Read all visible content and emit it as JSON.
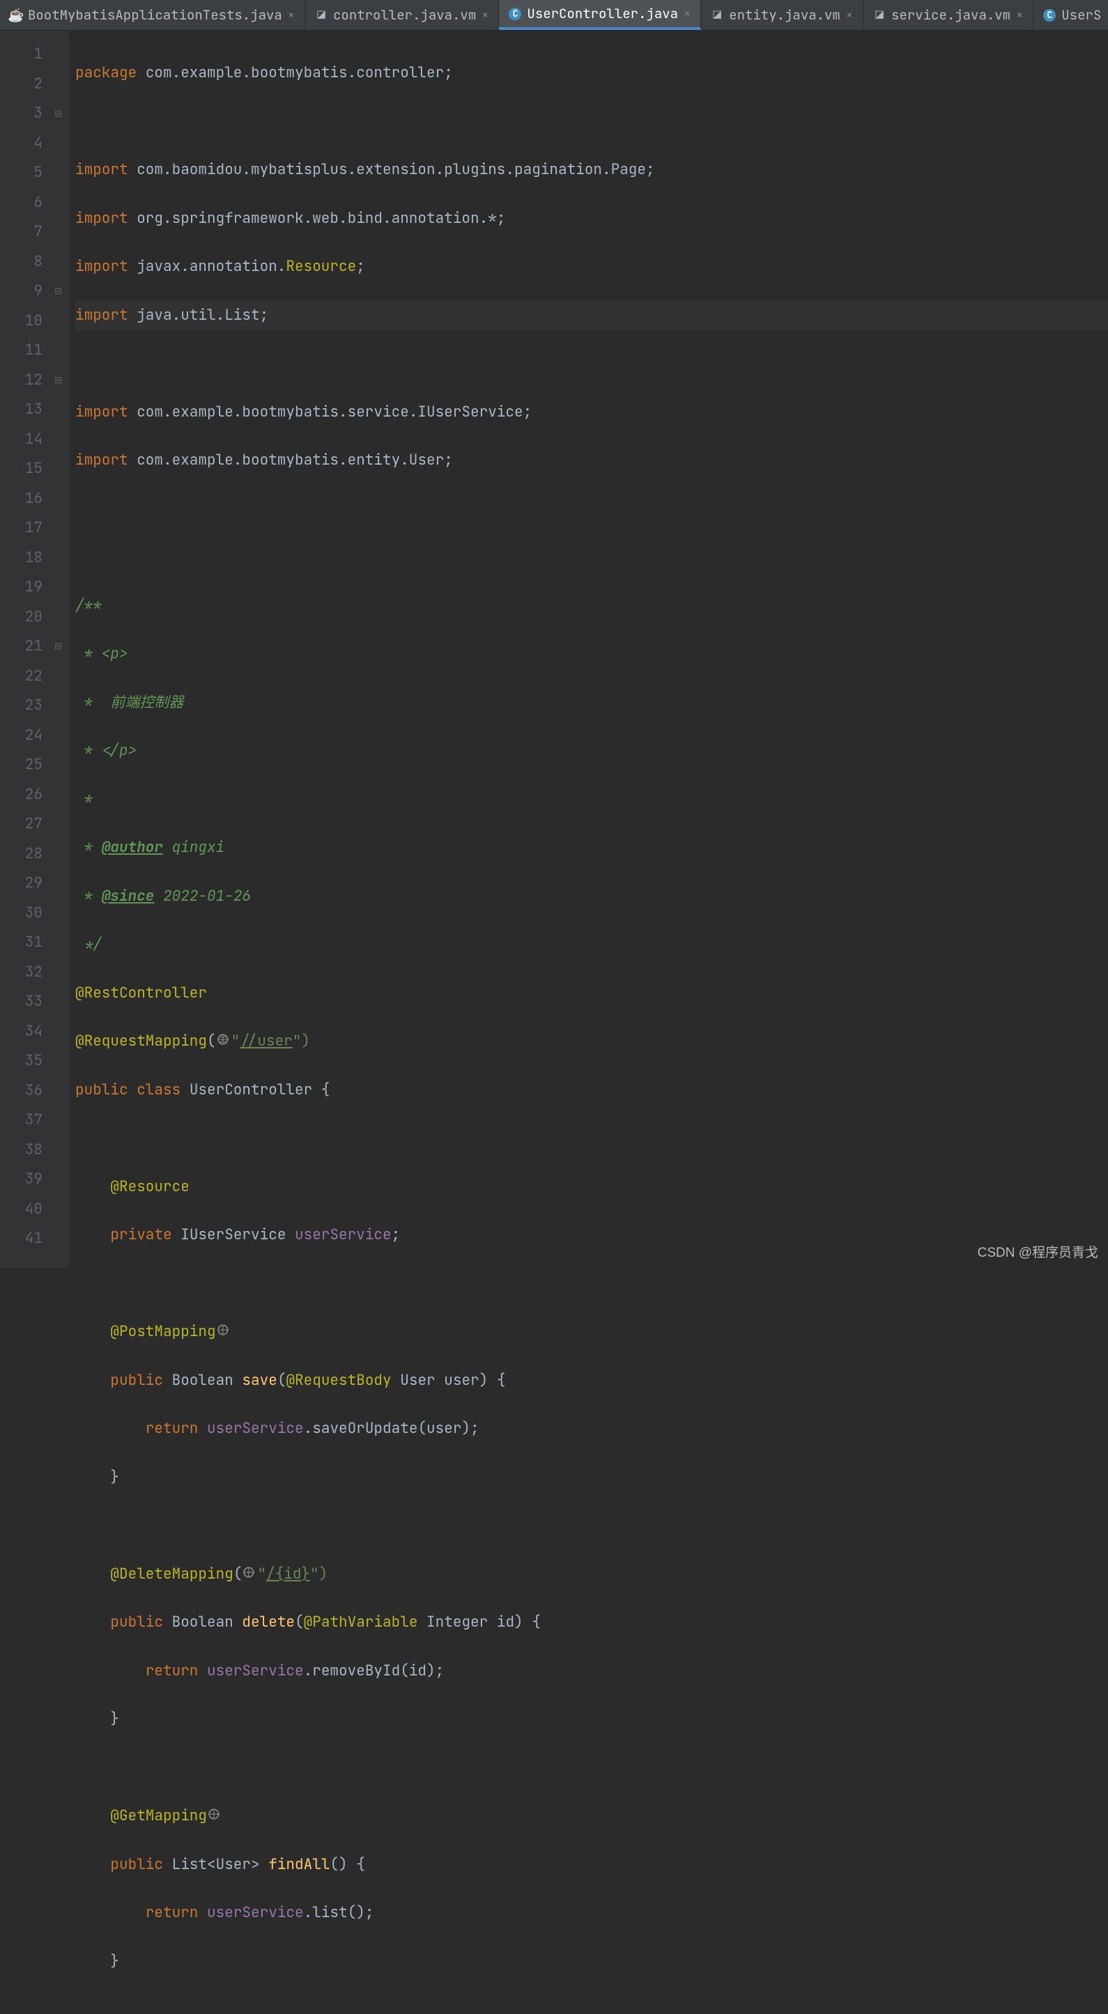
{
  "tabs": [
    {
      "label": "BootMybatisApplicationTests.java",
      "icon": "java",
      "active": false
    },
    {
      "label": "controller.java.vm",
      "icon": "vm",
      "active": false
    },
    {
      "label": "UserController.java",
      "icon": "c",
      "active": true
    },
    {
      "label": "entity.java.vm",
      "icon": "vm",
      "active": false
    },
    {
      "label": "service.java.vm",
      "icon": "vm",
      "active": false
    },
    {
      "label": "UserS",
      "icon": "c",
      "active": false,
      "truncated": true
    }
  ],
  "lineNumbers": [
    "1",
    "2",
    "3",
    "4",
    "5",
    "6",
    "7",
    "8",
    "9",
    "10",
    "11",
    "12",
    "13",
    "14",
    "15",
    "16",
    "17",
    "18",
    "19",
    "20",
    "21",
    "22",
    "23",
    "24",
    "25",
    "26",
    "27",
    "28",
    "29",
    "30",
    "31",
    "32",
    "33",
    "34",
    "35",
    "36",
    "37",
    "38",
    "39",
    "40",
    "41"
  ],
  "code": {
    "l1a": "package ",
    "l1b": "com.example.bootmybatis.controller",
    "l3a": "import ",
    "l3b": "com.baomidou.mybatisplus.extension.plugins.pagination.Page",
    "l4a": "import ",
    "l4b": "org.springframework.web.bind.annotation.*",
    "l5a": "import ",
    "l5b": "javax.annotation.",
    "l5c": "Resource",
    "l6a": "import ",
    "l6b": "java.util.List",
    "l8a": "import ",
    "l8b": "com.example.bootmybatis.service.IUserService",
    "l9a": "import ",
    "l9b": "com.example.bootmybatis.entity.User",
    "doc1": "/**",
    "doc2": " * <p>",
    "doc3": " *  前端控制器",
    "doc4": " * </p>",
    "doc5": " *",
    "doc6a": " * ",
    "doc6tag": "@author",
    "doc6b": " qingxi",
    "doc7a": " * ",
    "doc7tag": "@since",
    "doc7b": " 2022-01-26",
    "doc8": " */",
    "ann1": "@RestController",
    "ann2a": "@RequestMapping",
    "ann2s": "\"",
    "ann2path": "//user",
    "ann2e": "\")",
    "cls1": "public class ",
    "cls2": "UserController {",
    "ann3": "@Resource",
    "fld1": "private ",
    "fld2": "IUserService ",
    "fld3": "userService",
    "ann4": "@PostMapping",
    "m1a": "public ",
    "m1b": "Boolean ",
    "m1c": "save",
    "m1d": "(",
    "m1e": "@RequestBody",
    "m1f": " User user) {",
    "r1a": "return ",
    "r1b": "userService",
    "r1c": ".",
    "r1d": "saveOrUpdate",
    "r1e": "(user);",
    "cb": "}",
    "ann5a": "@DeleteMapping",
    "ann5s": "\"",
    "ann5path": "/{id}",
    "ann5e": "\")",
    "m2a": "public ",
    "m2b": "Boolean ",
    "m2c": "delete",
    "m2d": "(",
    "m2e": "@PathVariable",
    "m2f": " Integer id) {",
    "r2a": "return ",
    "r2b": "userService",
    "r2c": ".",
    "r2d": "removeById",
    "r2e": "(id);",
    "ann6": "@GetMapping",
    "m3a": "public ",
    "m3b": "List<User> ",
    "m3c": "findAll",
    "m3d": "() {",
    "r3a": "return ",
    "r3b": "userService",
    "r3c": ".",
    "r3d": "list",
    "r3e": "();"
  },
  "watermark": "CSDN @程序员青戈"
}
